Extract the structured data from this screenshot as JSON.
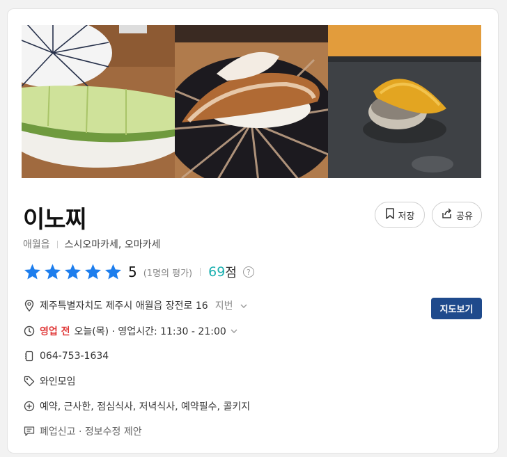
{
  "place": {
    "name": "이노찌",
    "area": "애월읍",
    "categories": "스시오마카세, 오마카세"
  },
  "actions": {
    "save_label": "저장",
    "share_label": "공유",
    "map_label": "지도보기"
  },
  "rating": {
    "stars": 5,
    "score": "5",
    "review_count": "(1명의 평가)",
    "points": "69",
    "points_unit": "점",
    "help_symbol": "?"
  },
  "info": {
    "address": "제주특별자치도 제주시 애월읍 장전로 16",
    "address_toggle": "지번",
    "status": "영업 전",
    "hours": "오늘(목) · 영업시간: 11:30 - 21:00",
    "phone": "064-753-1634",
    "tags": "와인모임",
    "features": "예약, 근사한, 점심식사, 저녁식사, 예약필수, 콜키지",
    "report": "폐업신고 · 정보수정 제안"
  },
  "colors": {
    "star": "#1c7ded",
    "points": "#1bb0b0",
    "status": "#e03a3a",
    "map_button": "#1f4a8c"
  },
  "icons": [
    "bookmark-icon",
    "share-icon",
    "star-icon",
    "help-icon",
    "location-pin-icon",
    "clock-icon",
    "phone-icon",
    "tag-icon",
    "plus-circle-icon",
    "report-icon",
    "chevron-down-icon"
  ]
}
